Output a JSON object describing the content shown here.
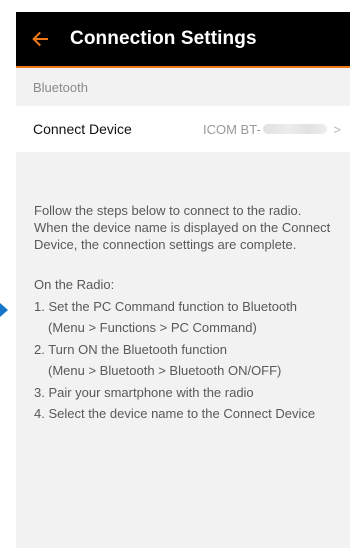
{
  "colors": {
    "appbar_bg": "#000000",
    "accent": "#f07a1a",
    "screen_bg": "#f2f2f2",
    "marker": "#1677c9"
  },
  "appbar": {
    "back_icon": "arrow-left-icon",
    "title": "Connection Settings"
  },
  "bluetooth_section": {
    "header": "Bluetooth",
    "connect_device": {
      "label": "Connect Device",
      "value_prefix": "ICOM BT-",
      "chevron": ">"
    }
  },
  "instructions": {
    "intro_lines": [
      "Follow the steps below to connect to the radio.",
      "When the device name is displayed on the Connect",
      "Device, the connection settings are complete."
    ],
    "heading": "On the Radio:",
    "steps": [
      {
        "text": "1. Set the PC Command function to Bluetooth",
        "sub": "(Menu > Functions > PC Command)"
      },
      {
        "text": "2. Turn ON the Bluetooth function",
        "sub": "(Menu > Bluetooth > Bluetooth ON/OFF)"
      },
      {
        "text": "3. Pair your smartphone with the radio",
        "sub": null
      },
      {
        "text": "4. Select the device name to the Connect Device",
        "sub": null
      }
    ]
  }
}
